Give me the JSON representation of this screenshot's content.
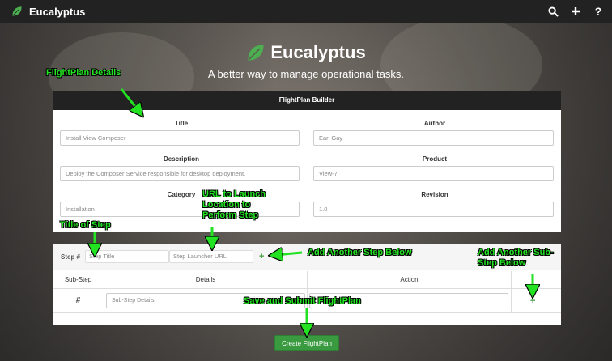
{
  "navbar": {
    "brand": "Eucalyptus",
    "icons": [
      "search-icon",
      "plus-icon",
      "help-icon"
    ],
    "help_glyph": "?"
  },
  "hero": {
    "title": "Eucalyptus",
    "subtitle": "A better way to manage operational tasks."
  },
  "builder": {
    "header": "FlightPlan Builder",
    "title_label": "Title",
    "title_value": "Install View Composer",
    "author_label": "Author",
    "author_value": "Earl Gay",
    "description_label": "Description",
    "description_value": "Deploy the Composer Service responsible for desktop deployment.",
    "product_label": "Product",
    "product_value": "View-7",
    "category_label": "Category",
    "category_value": "Installation",
    "revision_label": "Revision",
    "revision_value": "1.0"
  },
  "steps": {
    "step_label": "Step #",
    "step_title_placeholder": "Step Title",
    "step_url_placeholder": "Step Launcher URL",
    "add_step": "+",
    "col_substep": "Sub-Step",
    "col_details": "Details",
    "col_action": "Action",
    "row_number": "#",
    "substep_details_placeholder": "Sub-Step Details",
    "add_substep": "+"
  },
  "create_button": "Create FlightPlan",
  "annotations": {
    "flightplan_details": "FlightPlan Details",
    "url_to_launch": "URL to Launch Location to Perform Step",
    "title_of_step": "Title of Step",
    "add_another_step": "Add Another Step Below",
    "add_another_substep": "Add Another Sub-Step Below",
    "save_and_submit": "Save and Submit FlightPlan"
  },
  "colors": {
    "accent_green": "#3a9a40",
    "annotation_green": "#22e222",
    "navbar_bg": "#222222"
  }
}
